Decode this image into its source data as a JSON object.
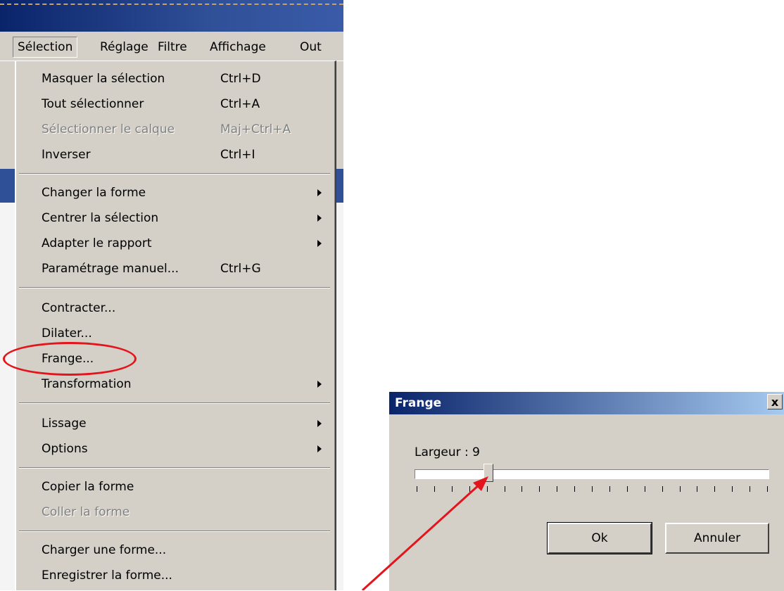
{
  "menubar": {
    "items": [
      "Sélection",
      "Réglage",
      "Filtre",
      "Affichage",
      "Out"
    ]
  },
  "menu": {
    "group1": [
      {
        "label": "Masquer la sélection",
        "shortcut": "Ctrl+D"
      },
      {
        "label": "Tout sélectionner",
        "shortcut": "Ctrl+A"
      },
      {
        "label": "Sélectionner le calque",
        "shortcut": "Maj+Ctrl+A",
        "disabled": true
      },
      {
        "label": "Inverser",
        "shortcut": "Ctrl+I"
      }
    ],
    "group2": [
      {
        "label": "Changer la forme",
        "submenu": true
      },
      {
        "label": "Centrer la sélection",
        "submenu": true
      },
      {
        "label": "Adapter le rapport",
        "submenu": true
      },
      {
        "label": "Paramétrage manuel...",
        "shortcut": "Ctrl+G"
      }
    ],
    "group3": [
      {
        "label": "Contracter..."
      },
      {
        "label": "Dilater..."
      },
      {
        "label": "Frange...",
        "highlighted": true
      },
      {
        "label": "Transformation",
        "submenu": true
      }
    ],
    "group4": [
      {
        "label": "Lissage",
        "submenu": true
      },
      {
        "label": "Options",
        "submenu": true
      }
    ],
    "group5": [
      {
        "label": "Copier la forme"
      },
      {
        "label": "Coller la forme",
        "disabled": true
      }
    ],
    "group6": [
      {
        "label": "Charger une forme..."
      },
      {
        "label": "Enregistrer la forme..."
      }
    ]
  },
  "dialog": {
    "title": "Frange",
    "close_label": "x",
    "width_label": "Largeur : 9",
    "slider": {
      "value_fraction": 0.2
    },
    "ok_label": "Ok",
    "cancel_label": "Annuler"
  },
  "colors": {
    "annotation": "#e3141b",
    "title_bar_start": "#0a246a",
    "title_bar_end": "#a6caf0"
  }
}
